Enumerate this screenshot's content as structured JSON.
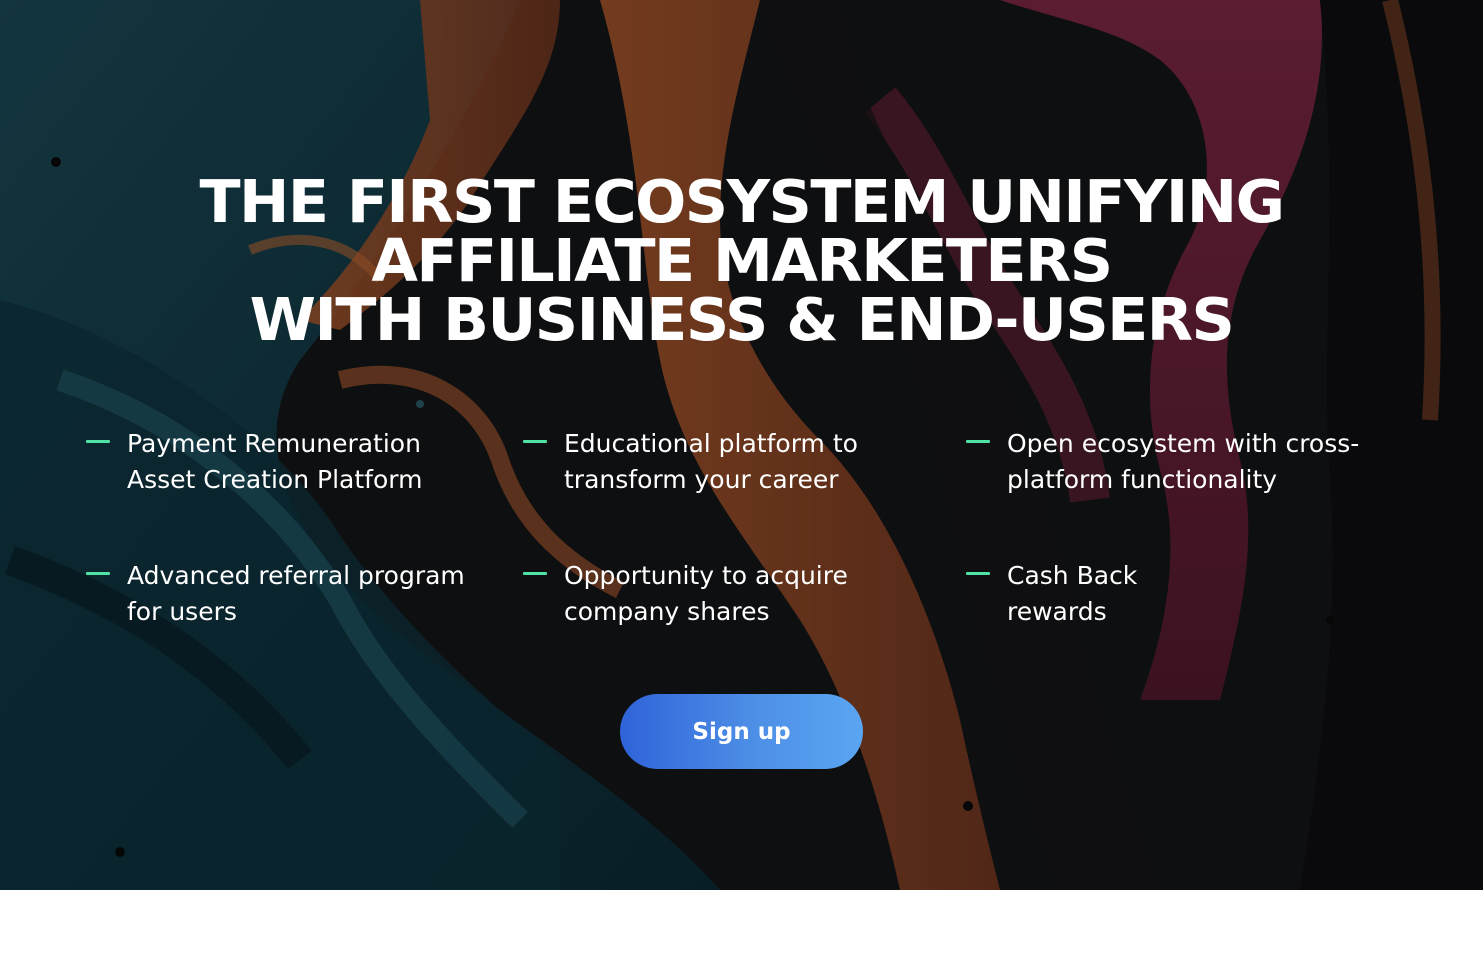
{
  "hero": {
    "headline_lines": [
      "THE FIRST ECOSYSTEM UNIFYING",
      "AFFILIATE MARKETERS",
      "WITH BUSINESS & END-USERS"
    ],
    "features": [
      "Payment Remuneration\nAsset Creation Platform",
      "Educational platform to\ntransform your career",
      "Open ecosystem with cross-\nplatform functionality",
      "Advanced referral program\nfor users",
      "Opportunity to acquire\ncompany shares",
      "Cash Back\nrewards"
    ],
    "signup_label": "Sign up",
    "colors": {
      "accent_dash": "#4fe3a6",
      "button_start": "#2f63d9",
      "button_end": "#5aa5f2"
    }
  }
}
